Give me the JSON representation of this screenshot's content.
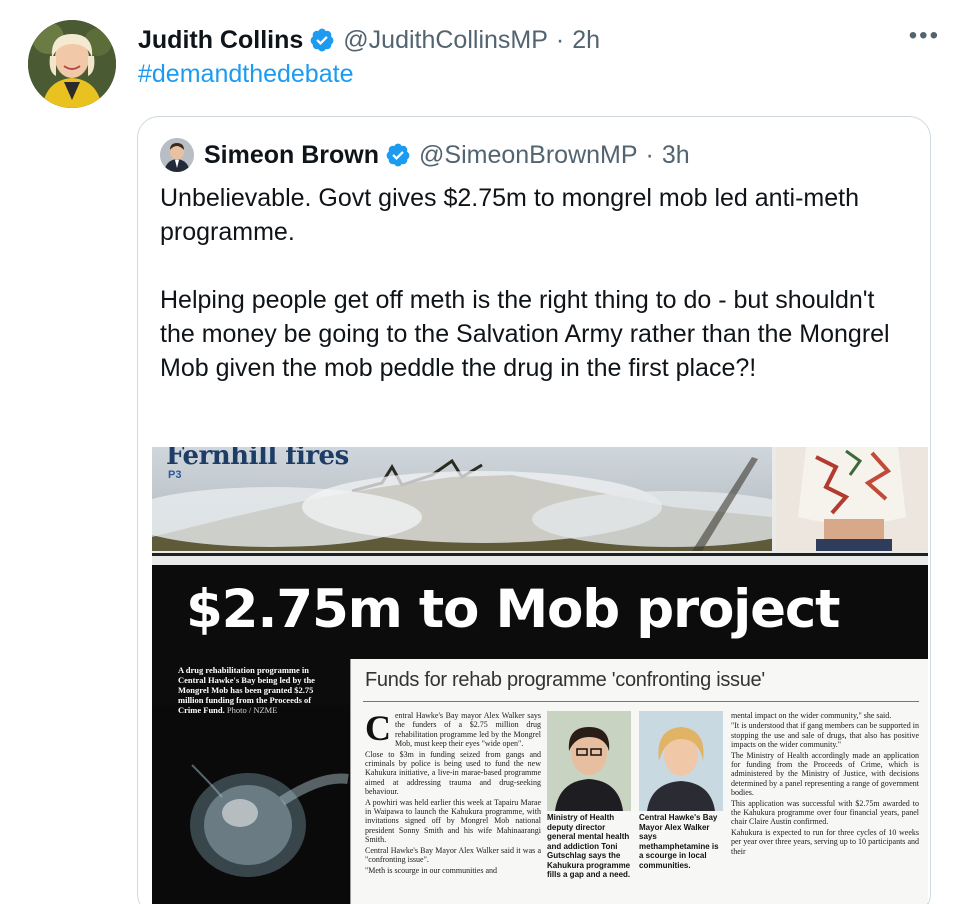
{
  "tweet": {
    "author_name": "Judith Collins",
    "handle": "@JudithCollinsMP",
    "separator": "·",
    "time": "2h",
    "more_label": "•••",
    "text": "#demandthedebate"
  },
  "quoted_tweet": {
    "author_name": "Simeon Brown",
    "handle": "@SimeonBrownMP",
    "separator": "·",
    "time": "3h",
    "paragraphs": [
      "Unbelievable. Govt gives $2.75m to mongrel mob led anti-meth programme.",
      "Helping people get off meth is the right thing to do - but shouldn't the money be going to the Salvation Army rather than the Mongrel Mob given the mob peddle the drug in the first place?!"
    ]
  },
  "newspaper": {
    "top_headline": "Fernhill fires",
    "page_ref": "P3",
    "headline": "$2.75m to Mob project",
    "photo_caption": "A drug rehabilitation programme in Central Hawke's Bay being led by the Mongrel Mob has been granted $2.75 million funding from the Proceeds of Crime Fund.",
    "photo_credit": "Photo / NZME",
    "subheadline": "Funds for rehab programme 'confronting issue'",
    "dropcap": "C",
    "col1": [
      "entral Hawke's Bay mayor Alex Walker says the funders of a $2.75 million drug rehabilitation programme led by the Mongrel Mob, must keep their eyes \"wide open\".",
      "Close to $3m in funding seized from gangs and criminals by police is being used to fund the new Kahukura initiative, a live-in marae-based programme aimed at addressing trauma and drug-seeking behaviour.",
      "A powhiri was held earlier this week at Tapairu Marae in Waipawa to launch the Kahukura programme, with invitations signed off by Mongrel Mob national president Sonny Smith and his wife Mahinaarangi Smith.",
      "Central Hawke's Bay Mayor Alex Walker said it was a \"confronting issue\".",
      "\"Meth is scourge in our communities and"
    ],
    "photo1_caption": "Ministry of Health deputy director general mental health and addiction Toni Gutschlag says the Kahukura programme fills a gap and a need.",
    "photo2_caption": "Central Hawke's Bay Mayor Alex Walker says methamphetamine is a scourge in local communities.",
    "col3": [
      "mental impact on the wider community,\" she said.",
      "\"It is understood that if gang members can be supported in stopping the use and sale of drugs, that also has positive impacts on the wider community.\"",
      "The Ministry of Health accordingly made an application for funding from the Proceeds of Crime, which is administered by the Ministry of Justice, with decisions determined by a panel representing a range of government bodies.",
      "This application was successful with $2.75m awarded to the Kahukura programme over four financial years, panel chair Claire Austin confirmed.",
      "Kahukura is expected to run for three cycles of 10 weeks per year over three years, serving up to 10 participants and their"
    ]
  },
  "colors": {
    "link": "#1d9bf0",
    "verified": "#1d9bf0",
    "secondary_text": "#536471",
    "border": "#cfd9de"
  }
}
